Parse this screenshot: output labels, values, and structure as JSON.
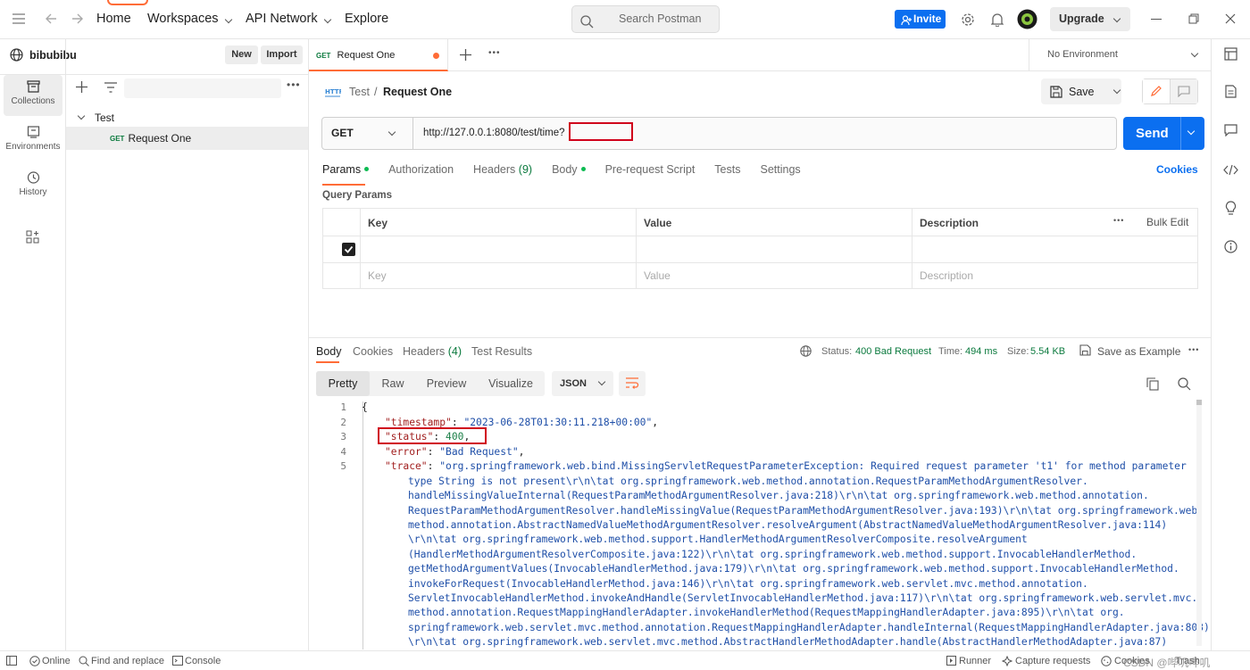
{
  "topbar": {
    "home": "Home",
    "workspaces": "Workspaces",
    "api_network": "API Network",
    "explore": "Explore",
    "search_placeholder": "Search Postman",
    "invite": "Invite",
    "upgrade": "Upgrade"
  },
  "workspace": {
    "name": "bibubibu",
    "new_label": "New",
    "import_label": "Import"
  },
  "rail": {
    "items": [
      "Collections",
      "Environments",
      "History"
    ]
  },
  "tree": {
    "collection": "Test",
    "request_method": "GET",
    "request_name": "Request One"
  },
  "tab": {
    "method": "GET",
    "name": "Request One",
    "environment": "No Environment"
  },
  "request": {
    "breadcrumb_parent": "Test",
    "breadcrumb_sep": "/",
    "breadcrumb_name": "Request One",
    "save_label": "Save",
    "method": "GET",
    "url": "http://127.0.0.1:8080/test/time?",
    "send_label": "Send",
    "tabs": {
      "params": "Params",
      "authorization": "Authorization",
      "headers": "Headers",
      "headers_count": "(9)",
      "body": "Body",
      "prerequest": "Pre-request Script",
      "tests": "Tests",
      "settings": "Settings"
    },
    "cookies_link": "Cookies",
    "query_params_title": "Query Params",
    "table": {
      "col_key": "Key",
      "col_value": "Value",
      "col_description": "Description",
      "bulk_edit": "Bulk Edit",
      "placeholder_key": "Key",
      "placeholder_value": "Value",
      "placeholder_description": "Description"
    }
  },
  "response": {
    "tabs": {
      "body": "Body",
      "cookies": "Cookies",
      "headers": "Headers",
      "headers_count": "(4)",
      "test_results": "Test Results"
    },
    "status_label": "Status:",
    "status_value": "400 Bad Request",
    "time_label": "Time:",
    "time_value": "494 ms",
    "size_label": "Size:",
    "size_value": "5.54 KB",
    "save_example": "Save as Example",
    "views": [
      "Pretty",
      "Raw",
      "Preview",
      "Visualize"
    ],
    "format": "JSON",
    "line_numbers": [
      "1",
      "2",
      "3",
      "4",
      "5"
    ],
    "json": {
      "open": "{",
      "timestamp_key": "\"timestamp\"",
      "timestamp_val": "\"2023-06-28T01:30:11.218+00:00\"",
      "status_key": "\"status\"",
      "status_val": "400",
      "error_key": "\"error\"",
      "error_val": "\"Bad Request\"",
      "trace_key": "\"trace\"",
      "trace_lines": [
        "\"org.springframework.web.bind.MissingServletRequestParameterException: Required request parameter 't1' for method parameter",
        "type String is not present\\r\\n\\tat org.springframework.web.method.annotation.RequestParamMethodArgumentResolver.",
        "handleMissingValueInternal(RequestParamMethodArgumentResolver.java:218)\\r\\n\\tat org.springframework.web.method.annotation.",
        "RequestParamMethodArgumentResolver.handleMissingValue(RequestParamMethodArgumentResolver.java:193)\\r\\n\\tat org.springframework.web.",
        "method.annotation.AbstractNamedValueMethodArgumentResolver.resolveArgument(AbstractNamedValueMethodArgumentResolver.java:114)",
        "\\r\\n\\tat org.springframework.web.method.support.HandlerMethodArgumentResolverComposite.resolveArgument",
        "(HandlerMethodArgumentResolverComposite.java:122)\\r\\n\\tat org.springframework.web.method.support.InvocableHandlerMethod.",
        "getMethodArgumentValues(InvocableHandlerMethod.java:179)\\r\\n\\tat org.springframework.web.method.support.InvocableHandlerMethod.",
        "invokeForRequest(InvocableHandlerMethod.java:146)\\r\\n\\tat org.springframework.web.servlet.mvc.method.annotation.",
        "ServletInvocableHandlerMethod.invokeAndHandle(ServletInvocableHandlerMethod.java:117)\\r\\n\\tat org.springframework.web.servlet.mvc.",
        "method.annotation.RequestMappingHandlerAdapter.invokeHandlerMethod(RequestMappingHandlerAdapter.java:895)\\r\\n\\tat org.",
        "springframework.web.servlet.mvc.method.annotation.RequestMappingHandlerAdapter.handleInternal(RequestMappingHandlerAdapter.java:808)",
        "\\r\\n\\tat org.springframework.web.servlet.mvc.method.AbstractHandlerMethodAdapter.handle(AbstractHandlerMethodAdapter.java:87)"
      ]
    }
  },
  "statusbar": {
    "online": "Online",
    "find_replace": "Find and replace",
    "console": "Console",
    "runner": "Runner",
    "capture": "Capture requests",
    "cookies": "Cookies",
    "trash": "Trash",
    "watermark": "CSDN @哔叽哔叽"
  },
  "colors": {
    "accent": "#0b6ff0",
    "brand": "#ff6c37",
    "status_error": "#0b7a3e",
    "highlight": "#d0021b"
  }
}
